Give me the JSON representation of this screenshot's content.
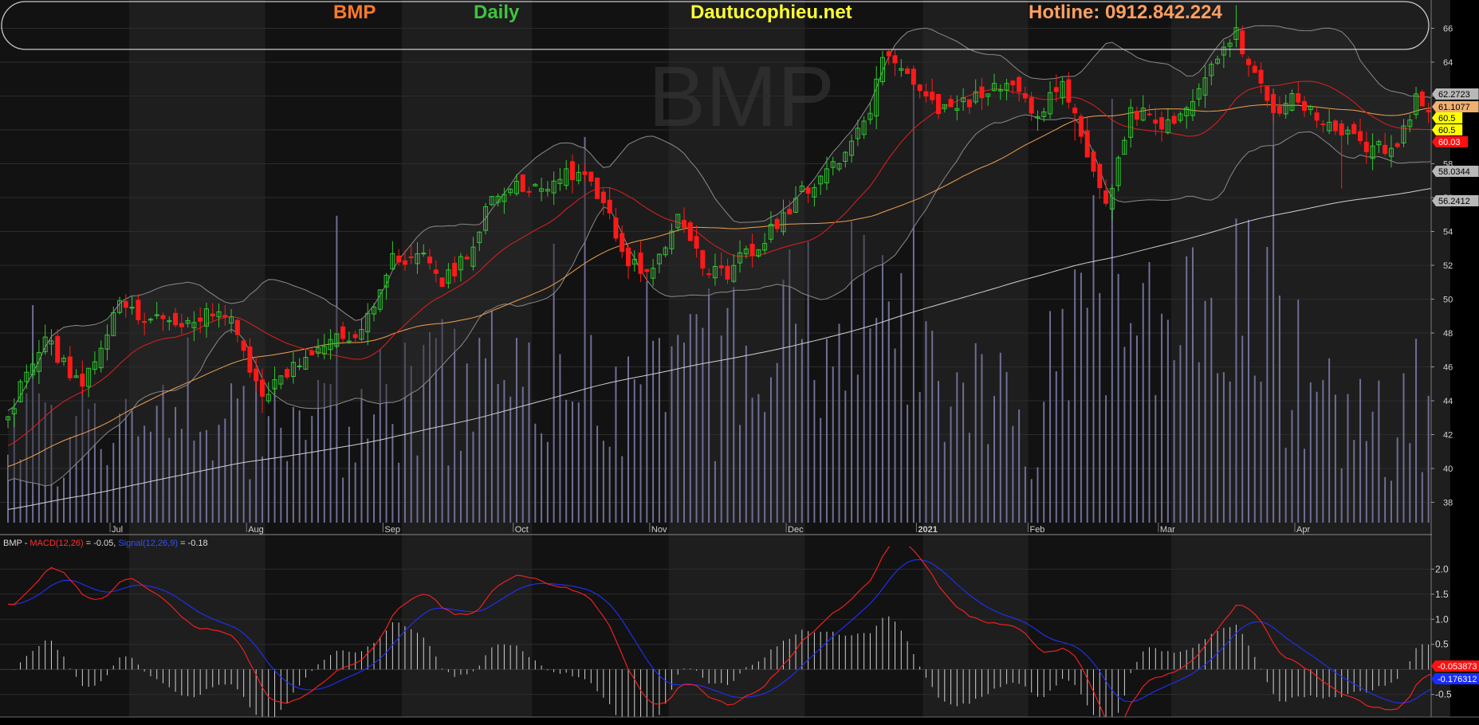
{
  "header": {
    "ticker": "BMP",
    "period": "Daily",
    "site": "Dautucophieu.net",
    "hotline": "Hotline: 0912.842.224"
  },
  "watermark": "BMP",
  "colors": {
    "ticker": "#ff7a2b",
    "period": "#3ec43e",
    "site": "#ffff33",
    "hotline": "#ffa060",
    "up": "#31c831",
    "down": "#ff1a1a",
    "ma_fast": "#e02020",
    "ma_mid": "#f0a050",
    "ma_slow": "#d0d0d0",
    "bb": "#8a8a8a",
    "volume": "#6e6e96",
    "macd": "#ff2020",
    "signal": "#2030ff"
  },
  "chart_data": [
    {
      "type": "candlestick",
      "symbol": "BMP",
      "interval": "daily",
      "x_labels": [
        "Jul",
        "Aug",
        "Sep",
        "Oct",
        "Nov",
        "Dec",
        "2021",
        "Feb",
        "Mar",
        "Apr"
      ],
      "y_ticks": [
        38,
        40,
        42,
        44,
        46,
        48,
        50,
        52,
        54,
        56,
        58,
        60,
        62,
        64,
        66
      ],
      "ylim": [
        36.8,
        67.2
      ],
      "anchors_close": [
        [
          0,
          43.2
        ],
        [
          6,
          47.5
        ],
        [
          12,
          45.0
        ],
        [
          18,
          49.8
        ],
        [
          24,
          48.6
        ],
        [
          30,
          48.8
        ],
        [
          36,
          49.3
        ],
        [
          41,
          44.0
        ],
        [
          46,
          46.3
        ],
        [
          52,
          47.6
        ],
        [
          57,
          48.2
        ],
        [
          62,
          52.2
        ],
        [
          66,
          52.8
        ],
        [
          70,
          51.0
        ],
        [
          74,
          52.5
        ],
        [
          78,
          56.2
        ],
        [
          82,
          56.6
        ],
        [
          88,
          57.0
        ],
        [
          92,
          57.5
        ],
        [
          96,
          55.5
        ],
        [
          100,
          52.2
        ],
        [
          104,
          51.8
        ],
        [
          108,
          54.8
        ],
        [
          112,
          52.0
        ],
        [
          116,
          51.5
        ],
        [
          120,
          53.0
        ],
        [
          124,
          54.5
        ],
        [
          128,
          56.5
        ],
        [
          132,
          57.3
        ],
        [
          136,
          59.5
        ],
        [
          139,
          61.0
        ],
        [
          141,
          64.3
        ],
        [
          146,
          62.6
        ],
        [
          150,
          61.2
        ],
        [
          154,
          61.6
        ],
        [
          158,
          62.4
        ],
        [
          161,
          62.8
        ],
        [
          166,
          61.0
        ],
        [
          170,
          62.9
        ],
        [
          174,
          58.2
        ],
        [
          177,
          55.2
        ],
        [
          181,
          61.0
        ],
        [
          186,
          60.5
        ],
        [
          190,
          61.0
        ],
        [
          194,
          63.6
        ],
        [
          198,
          65.6
        ],
        [
          201,
          63.5
        ],
        [
          204,
          61.3
        ],
        [
          208,
          61.8
        ],
        [
          212,
          60.5
        ],
        [
          216,
          59.9
        ],
        [
          220,
          58.8
        ],
        [
          224,
          59.4
        ],
        [
          227,
          61.7
        ],
        [
          231,
          60.6
        ],
        [
          233,
          60.4
        ]
      ],
      "volume_anchors": [
        [
          0,
          4
        ],
        [
          30,
          4
        ],
        [
          60,
          5
        ],
        [
          80,
          6.5
        ],
        [
          100,
          5
        ],
        [
          120,
          7.5
        ],
        [
          136,
          9.5
        ],
        [
          150,
          6
        ],
        [
          165,
          4.5
        ],
        [
          174,
          10
        ],
        [
          186,
          7
        ],
        [
          198,
          10
        ],
        [
          212,
          5
        ],
        [
          233,
          4
        ]
      ],
      "indicators": {
        "ma_fast": 20,
        "ma_mid": 50,
        "ma_slow": 200,
        "bollinger": [
          20,
          2
        ]
      },
      "last_values": [
        {
          "label": "62.2723",
          "value": 62.2723,
          "bg": "#b8b8b8",
          "fg": "#000000"
        },
        {
          "label": "61.1077",
          "value": 61.1077,
          "bg": "#f0b070",
          "fg": "#000000"
        },
        {
          "label": "60.5",
          "value": 60.5,
          "bg": "#ffff00",
          "fg": "#000000"
        },
        {
          "label": "60.5",
          "value": 60.5,
          "bg": "#ffff00",
          "fg": "#000000"
        },
        {
          "label": "60.03",
          "value": 60.03,
          "bg": "#ff1010",
          "fg": "#ffffff"
        },
        {
          "label": "58.0344",
          "value": 58.0344,
          "bg": "#b8b8b8",
          "fg": "#000000"
        },
        {
          "label": "56.2412",
          "value": 56.2412,
          "bg": "#b8b8b8",
          "fg": "#000000"
        }
      ]
    },
    {
      "type": "line",
      "title": "MACD",
      "legend": {
        "prefix": "BMP - ",
        "macd_label": "MACD(12,26)",
        "macd_value": " = -0.05, ",
        "signal_label": "Signal(12,26,9)",
        "signal_value": " = -0.18"
      },
      "y_ticks": [
        -0.5,
        0.5,
        1.0,
        1.5,
        2.0
      ],
      "y_tick_labels": [
        "-0.5",
        "0.5",
        "1.0",
        "1.5",
        "2.0"
      ],
      "ylim": [
        -0.95,
        2.45
      ],
      "last_values": [
        {
          "label": "-0.053873",
          "value": -0.053873,
          "bg": "#ff1010",
          "fg": "#ffffff"
        },
        {
          "label": "-0.176312",
          "value": -0.176312,
          "bg": "#1a2cff",
          "fg": "#ffffff"
        }
      ]
    }
  ]
}
